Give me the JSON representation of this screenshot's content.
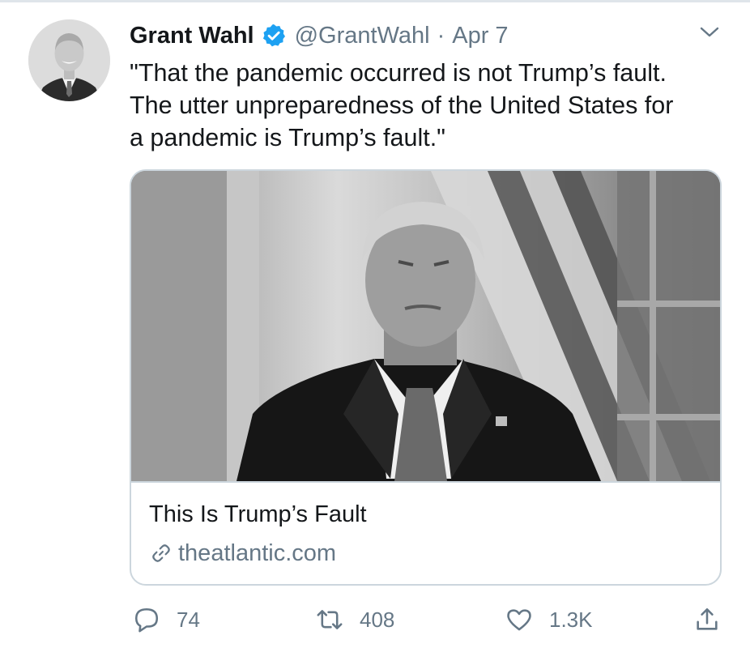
{
  "tweet": {
    "author_name": "Grant Wahl",
    "author_handle": "@GrantWahl",
    "separator": "·",
    "date": "Apr 7",
    "text": "\"That the pandemic occurred is not Trump’s fault.\nThe utter unpreparedness of the United States for\na pandemic is Trump’s fault.\"",
    "verified": true
  },
  "card": {
    "title": "This Is Trump’s Fault",
    "domain": "theatlantic.com"
  },
  "actions": {
    "replies": "74",
    "retweets": "408",
    "likes": "1.3K"
  },
  "icons": {
    "verified": "verified-badge-icon",
    "menu": "chevron-down-icon",
    "link": "link-icon",
    "reply": "reply-icon",
    "retweet": "retweet-icon",
    "like": "heart-icon",
    "share": "share-icon"
  },
  "colors": {
    "text": "#14171a",
    "secondary": "#657786",
    "verified": "#1da1f2",
    "border": "#ccd6dd"
  }
}
